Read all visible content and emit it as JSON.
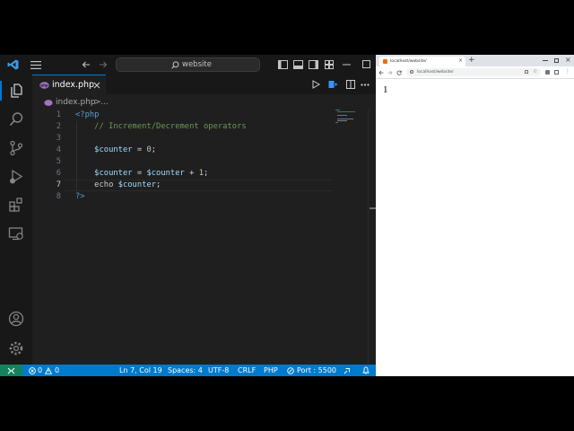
{
  "vscode": {
    "search": {
      "label": "website"
    },
    "tab": {
      "filename": "index.php"
    },
    "breadcrumb": {
      "file": "index.php",
      "sep": ">",
      "rest": "..."
    },
    "code_lines": [
      {
        "num": "1",
        "segments": [
          {
            "t": "<?php",
            "c": "#569cd6"
          }
        ]
      },
      {
        "num": "2",
        "segments": [
          {
            "t": "    // Increment/Decrement operators",
            "c": "#6a9955"
          }
        ]
      },
      {
        "num": "3",
        "segments": []
      },
      {
        "num": "4",
        "segments": [
          {
            "t": "    $counter",
            "c": "#9cdcfe"
          },
          {
            "t": " = ",
            "c": "#d4d4d4"
          },
          {
            "t": "0",
            "c": "#b5cea8"
          },
          {
            "t": ";",
            "c": "#d4d4d4"
          }
        ]
      },
      {
        "num": "5",
        "segments": []
      },
      {
        "num": "6",
        "segments": [
          {
            "t": "    $counter",
            "c": "#9cdcfe"
          },
          {
            "t": " = ",
            "c": "#d4d4d4"
          },
          {
            "t": "$counter",
            "c": "#9cdcfe"
          },
          {
            "t": " + ",
            "c": "#d4d4d4"
          },
          {
            "t": "1",
            "c": "#b5cea8"
          },
          {
            "t": ";",
            "c": "#d4d4d4"
          }
        ]
      },
      {
        "num": "7",
        "segments": [
          {
            "t": "    echo",
            "c": "#cccccc"
          },
          {
            "t": " ",
            "c": "#d4d4d4"
          },
          {
            "t": "$counter",
            "c": "#9cdcfe"
          },
          {
            "t": ";",
            "c": "#d4d4d4"
          }
        ]
      },
      {
        "num": "8",
        "segments": [
          {
            "t": "?>",
            "c": "#569cd6"
          }
        ]
      }
    ],
    "active_line": "7",
    "status": {
      "errors": "0",
      "warnings": "0",
      "position": "Ln 7, Col 19",
      "spaces": "Spaces: 4",
      "encoding": "UTF-8",
      "eol": "CRLF",
      "language": "PHP",
      "port": "Port : 5500"
    }
  },
  "browser": {
    "tab_title": "localhost/website/",
    "url": "localhost/website/",
    "page_output": "1"
  },
  "colors": {
    "accent": "#0078d4",
    "statusbar": "#007acc",
    "php_icon": "#a074c4"
  }
}
